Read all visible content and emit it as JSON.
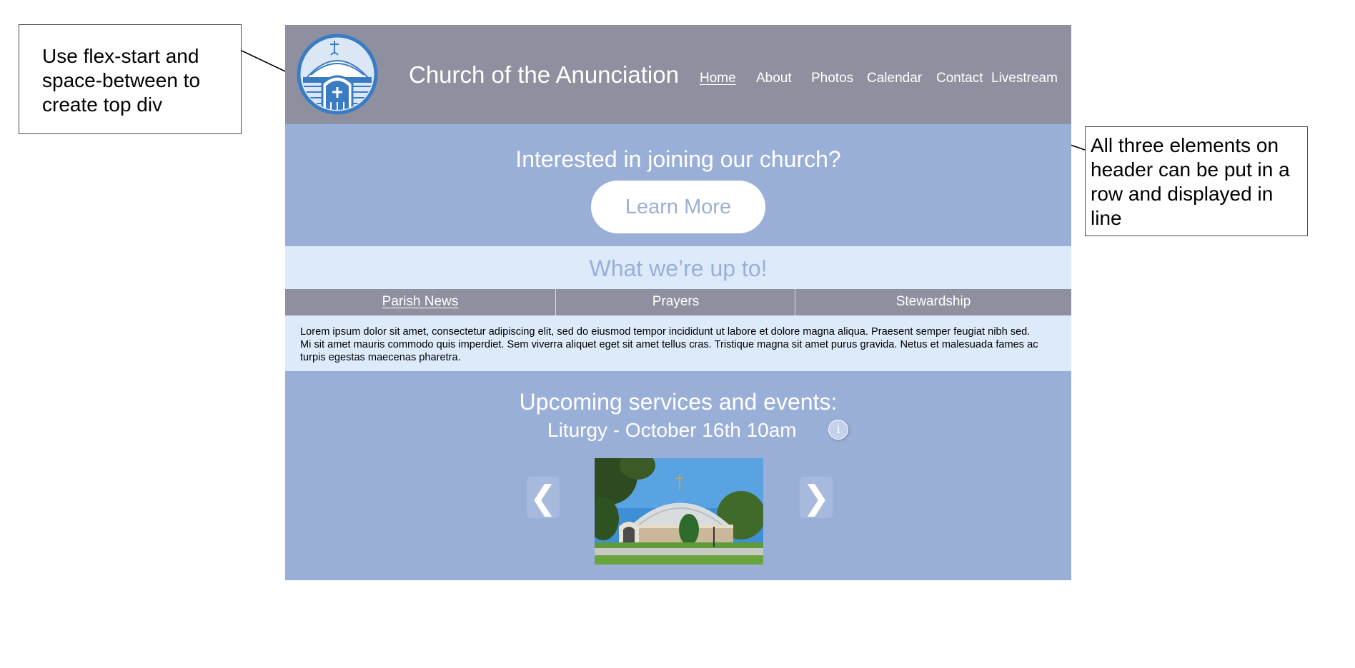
{
  "annotations": {
    "left_note": "Use flex-start and space-between to create top div",
    "right_note": "All three elements on header can be put in a row and displayed in line"
  },
  "header": {
    "logo_icon": "church-logo-icon",
    "title": "Church of the Anunciation",
    "nav": [
      {
        "label": "Home",
        "active": true
      },
      {
        "label": "About",
        "active": false
      },
      {
        "label": "Photos",
        "active": false
      },
      {
        "label": "Calendar",
        "active": false
      },
      {
        "label": "Contact",
        "active": false
      },
      {
        "label": "Livestream",
        "active": false
      }
    ]
  },
  "join": {
    "heading": "Interested in joining our church?",
    "button_label": "Learn More"
  },
  "updates": {
    "heading": "What we’re up to!",
    "tabs": [
      {
        "label": "Parish News",
        "active": true
      },
      {
        "label": "Prayers",
        "active": false
      },
      {
        "label": "Stewardship",
        "active": false
      }
    ],
    "body": "Lorem ipsum dolor sit amet, consectetur adipiscing elit, sed do eiusmod tempor incididunt ut labore et dolore magna aliqua. Praesent semper feugiat nibh sed. Mi sit amet mauris commodo quis imperdiet. Sem viverra aliquet eget sit amet tellus cras. Tristique magna sit amet purus gravida. Netus et malesuada fames ac turpis egestas maecenas pharetra."
  },
  "events": {
    "heading": "Upcoming services and events:",
    "event": "Liturgy - October 16th 10am",
    "info_icon": "info-icon",
    "prev_glyph": "❮",
    "next_glyph": "❯",
    "prev_icon": "chevron-left-icon",
    "next_icon": "chevron-right-icon",
    "photo": "church-building-photo"
  },
  "colors": {
    "header_bg": "#8f909f",
    "accent_blue": "#9aafd8",
    "light_blue": "#ddeafa",
    "logo_blue": "#3a7cc4"
  }
}
